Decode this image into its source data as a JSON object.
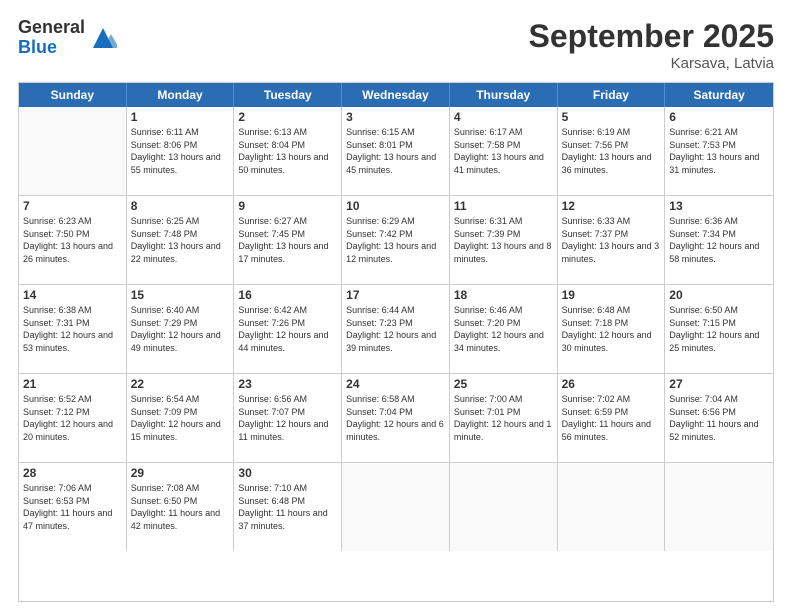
{
  "logo": {
    "general": "General",
    "blue": "Blue"
  },
  "title": "September 2025",
  "location": "Karsava, Latvia",
  "header_days": [
    "Sunday",
    "Monday",
    "Tuesday",
    "Wednesday",
    "Thursday",
    "Friday",
    "Saturday"
  ],
  "weeks": [
    [
      {
        "day": "",
        "sunrise": "",
        "sunset": "",
        "daylight": ""
      },
      {
        "day": "1",
        "sunrise": "Sunrise: 6:11 AM",
        "sunset": "Sunset: 8:06 PM",
        "daylight": "Daylight: 13 hours and 55 minutes."
      },
      {
        "day": "2",
        "sunrise": "Sunrise: 6:13 AM",
        "sunset": "Sunset: 8:04 PM",
        "daylight": "Daylight: 13 hours and 50 minutes."
      },
      {
        "day": "3",
        "sunrise": "Sunrise: 6:15 AM",
        "sunset": "Sunset: 8:01 PM",
        "daylight": "Daylight: 13 hours and 45 minutes."
      },
      {
        "day": "4",
        "sunrise": "Sunrise: 6:17 AM",
        "sunset": "Sunset: 7:58 PM",
        "daylight": "Daylight: 13 hours and 41 minutes."
      },
      {
        "day": "5",
        "sunrise": "Sunrise: 6:19 AM",
        "sunset": "Sunset: 7:56 PM",
        "daylight": "Daylight: 13 hours and 36 minutes."
      },
      {
        "day": "6",
        "sunrise": "Sunrise: 6:21 AM",
        "sunset": "Sunset: 7:53 PM",
        "daylight": "Daylight: 13 hours and 31 minutes."
      }
    ],
    [
      {
        "day": "7",
        "sunrise": "Sunrise: 6:23 AM",
        "sunset": "Sunset: 7:50 PM",
        "daylight": "Daylight: 13 hours and 26 minutes."
      },
      {
        "day": "8",
        "sunrise": "Sunrise: 6:25 AM",
        "sunset": "Sunset: 7:48 PM",
        "daylight": "Daylight: 13 hours and 22 minutes."
      },
      {
        "day": "9",
        "sunrise": "Sunrise: 6:27 AM",
        "sunset": "Sunset: 7:45 PM",
        "daylight": "Daylight: 13 hours and 17 minutes."
      },
      {
        "day": "10",
        "sunrise": "Sunrise: 6:29 AM",
        "sunset": "Sunset: 7:42 PM",
        "daylight": "Daylight: 13 hours and 12 minutes."
      },
      {
        "day": "11",
        "sunrise": "Sunrise: 6:31 AM",
        "sunset": "Sunset: 7:39 PM",
        "daylight": "Daylight: 13 hours and 8 minutes."
      },
      {
        "day": "12",
        "sunrise": "Sunrise: 6:33 AM",
        "sunset": "Sunset: 7:37 PM",
        "daylight": "Daylight: 13 hours and 3 minutes."
      },
      {
        "day": "13",
        "sunrise": "Sunrise: 6:36 AM",
        "sunset": "Sunset: 7:34 PM",
        "daylight": "Daylight: 12 hours and 58 minutes."
      }
    ],
    [
      {
        "day": "14",
        "sunrise": "Sunrise: 6:38 AM",
        "sunset": "Sunset: 7:31 PM",
        "daylight": "Daylight: 12 hours and 53 minutes."
      },
      {
        "day": "15",
        "sunrise": "Sunrise: 6:40 AM",
        "sunset": "Sunset: 7:29 PM",
        "daylight": "Daylight: 12 hours and 49 minutes."
      },
      {
        "day": "16",
        "sunrise": "Sunrise: 6:42 AM",
        "sunset": "Sunset: 7:26 PM",
        "daylight": "Daylight: 12 hours and 44 minutes."
      },
      {
        "day": "17",
        "sunrise": "Sunrise: 6:44 AM",
        "sunset": "Sunset: 7:23 PM",
        "daylight": "Daylight: 12 hours and 39 minutes."
      },
      {
        "day": "18",
        "sunrise": "Sunrise: 6:46 AM",
        "sunset": "Sunset: 7:20 PM",
        "daylight": "Daylight: 12 hours and 34 minutes."
      },
      {
        "day": "19",
        "sunrise": "Sunrise: 6:48 AM",
        "sunset": "Sunset: 7:18 PM",
        "daylight": "Daylight: 12 hours and 30 minutes."
      },
      {
        "day": "20",
        "sunrise": "Sunrise: 6:50 AM",
        "sunset": "Sunset: 7:15 PM",
        "daylight": "Daylight: 12 hours and 25 minutes."
      }
    ],
    [
      {
        "day": "21",
        "sunrise": "Sunrise: 6:52 AM",
        "sunset": "Sunset: 7:12 PM",
        "daylight": "Daylight: 12 hours and 20 minutes."
      },
      {
        "day": "22",
        "sunrise": "Sunrise: 6:54 AM",
        "sunset": "Sunset: 7:09 PM",
        "daylight": "Daylight: 12 hours and 15 minutes."
      },
      {
        "day": "23",
        "sunrise": "Sunrise: 6:56 AM",
        "sunset": "Sunset: 7:07 PM",
        "daylight": "Daylight: 12 hours and 11 minutes."
      },
      {
        "day": "24",
        "sunrise": "Sunrise: 6:58 AM",
        "sunset": "Sunset: 7:04 PM",
        "daylight": "Daylight: 12 hours and 6 minutes."
      },
      {
        "day": "25",
        "sunrise": "Sunrise: 7:00 AM",
        "sunset": "Sunset: 7:01 PM",
        "daylight": "Daylight: 12 hours and 1 minute."
      },
      {
        "day": "26",
        "sunrise": "Sunrise: 7:02 AM",
        "sunset": "Sunset: 6:59 PM",
        "daylight": "Daylight: 11 hours and 56 minutes."
      },
      {
        "day": "27",
        "sunrise": "Sunrise: 7:04 AM",
        "sunset": "Sunset: 6:56 PM",
        "daylight": "Daylight: 11 hours and 52 minutes."
      }
    ],
    [
      {
        "day": "28",
        "sunrise": "Sunrise: 7:06 AM",
        "sunset": "Sunset: 6:53 PM",
        "daylight": "Daylight: 11 hours and 47 minutes."
      },
      {
        "day": "29",
        "sunrise": "Sunrise: 7:08 AM",
        "sunset": "Sunset: 6:50 PM",
        "daylight": "Daylight: 11 hours and 42 minutes."
      },
      {
        "day": "30",
        "sunrise": "Sunrise: 7:10 AM",
        "sunset": "Sunset: 6:48 PM",
        "daylight": "Daylight: 11 hours and 37 minutes."
      },
      {
        "day": "",
        "sunrise": "",
        "sunset": "",
        "daylight": ""
      },
      {
        "day": "",
        "sunrise": "",
        "sunset": "",
        "daylight": ""
      },
      {
        "day": "",
        "sunrise": "",
        "sunset": "",
        "daylight": ""
      },
      {
        "day": "",
        "sunrise": "",
        "sunset": "",
        "daylight": ""
      }
    ]
  ]
}
